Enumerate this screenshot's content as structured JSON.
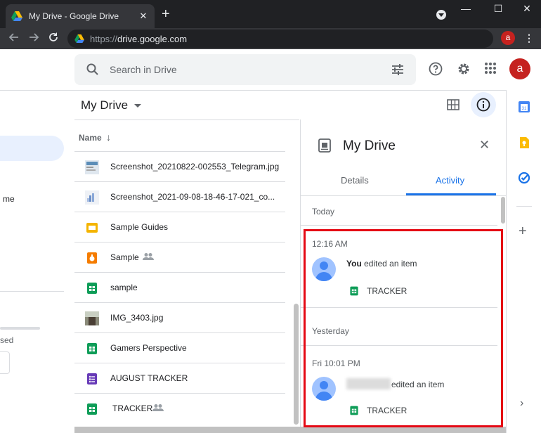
{
  "browser": {
    "tab_title": "My Drive - Google Drive",
    "tab_close": "✕",
    "new_tab": "+",
    "window_controls": {
      "minimize": "—",
      "maximize": "☐",
      "close": "✕"
    },
    "url_proto": "https://",
    "url_host": "drive.google.com",
    "avatar_letter": "a"
  },
  "header": {
    "search_placeholder": "Search in Drive",
    "avatar_letter": "a",
    "brand_color": "#c5221f"
  },
  "sidebar": {
    "partial_item_label": "me",
    "storage_text": "sed"
  },
  "list": {
    "title": "My Drive",
    "column_name": "Name",
    "sort_arrow": "↓",
    "files": [
      {
        "name": "Screenshot_20210822-002553_Telegram.jpg",
        "icon": "image-thumbnail"
      },
      {
        "name": "Screenshot_2021-09-08-18-46-17-021_co...",
        "icon": "image-thumbnail"
      },
      {
        "name": "Sample Guides",
        "icon": "slides-icon"
      },
      {
        "name": "Sample",
        "icon": "shared-folder-icon",
        "shared": true
      },
      {
        "name": "sample",
        "icon": "sheets-icon"
      },
      {
        "name": "IMG_3403.jpg",
        "icon": "image-thumbnail"
      },
      {
        "name": "Gamers Perspective",
        "icon": "sheets-icon"
      },
      {
        "name": "AUGUST TRACKER",
        "icon": "forms-icon"
      },
      {
        "name": "TRACKER",
        "icon": "sheets-icon",
        "shared": true
      }
    ]
  },
  "panel": {
    "title": "My Drive",
    "close": "✕",
    "tabs": [
      "Details",
      "Activity"
    ],
    "active_tab": "Activity",
    "sections": [
      {
        "label": "Today",
        "entries": [
          {
            "time": "12:16 AM",
            "actor": "You",
            "action": " edited an item",
            "file": "TRACKER"
          }
        ]
      },
      {
        "label": "Yesterday",
        "entries": [
          {
            "time": "Fri 10:01 PM",
            "actor": "",
            "action": "edited an item",
            "file": "TRACKER"
          }
        ]
      }
    ]
  },
  "rail": {
    "plus": "+",
    "chevron": "›"
  }
}
